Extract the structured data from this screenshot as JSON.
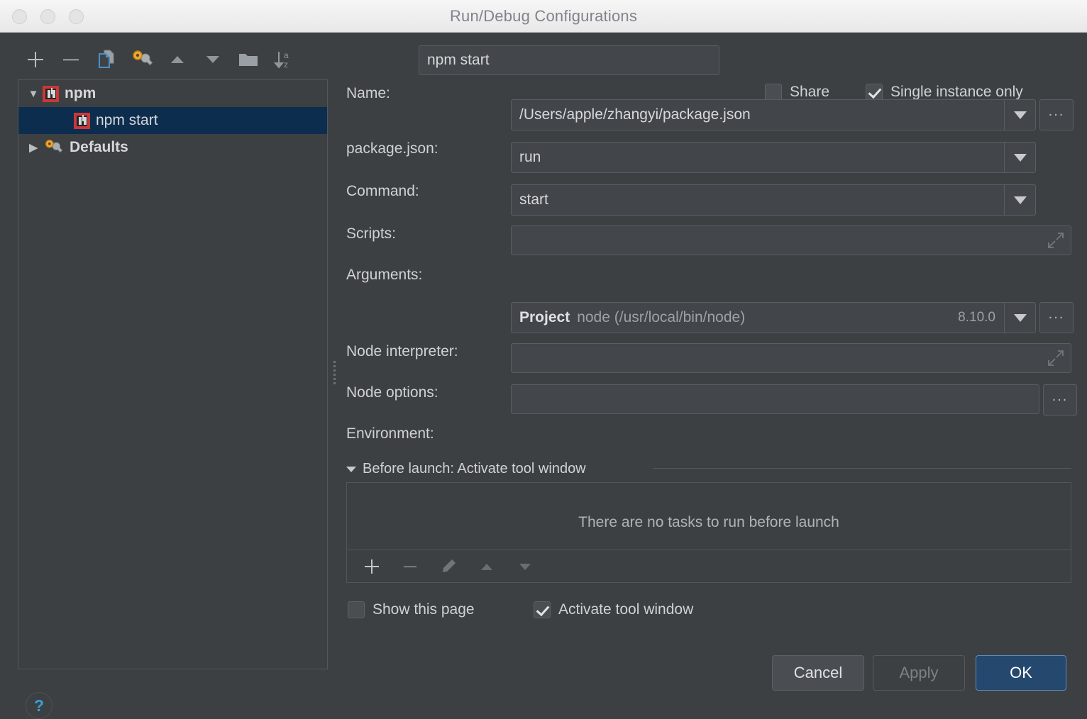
{
  "window": {
    "title": "Run/Debug Configurations",
    "traffic_lights": [
      "close-button",
      "minimize-button",
      "zoom-button"
    ]
  },
  "tree_toolbar": {
    "buttons": [
      {
        "name": "add-configuration-button",
        "icon": "plus-icon",
        "tooltip": "Add New Configuration"
      },
      {
        "name": "remove-configuration-button",
        "icon": "minus-icon",
        "tooltip": "Remove Configuration"
      },
      {
        "name": "copy-configuration-button",
        "icon": "copy-icon",
        "tooltip": "Copy Configuration"
      },
      {
        "name": "edit-defaults-button",
        "icon": "wrench-gear-icon",
        "tooltip": "Edit defaults"
      },
      {
        "name": "move-up-button",
        "icon": "arrow-up-icon",
        "tooltip": "Move Up"
      },
      {
        "name": "move-down-button",
        "icon": "arrow-down-icon",
        "tooltip": "Move Down"
      },
      {
        "name": "create-folder-button",
        "icon": "folder-icon",
        "tooltip": "Create New Folder"
      },
      {
        "name": "sort-button",
        "icon": "sort-alpha-icon",
        "tooltip": "Sort Configurations"
      }
    ]
  },
  "tree": {
    "items": [
      {
        "label": "npm",
        "level": 0,
        "expander": "▼",
        "icon": "npm-icon",
        "selected": false,
        "bold": true
      },
      {
        "label": "npm start",
        "level": 1,
        "expander": "",
        "icon": "npm-icon",
        "selected": true,
        "bold": false
      },
      {
        "label": "Defaults",
        "level": 0,
        "expander": "▶",
        "icon": "wrench-gear-icon",
        "selected": false,
        "bold": true
      }
    ]
  },
  "help": {
    "label": "?",
    "name": "help-button"
  },
  "form": {
    "name": {
      "label": "Name:",
      "value": "npm start"
    },
    "share": {
      "label": "Share",
      "checked": false
    },
    "single_instance": {
      "label": "Single instance only",
      "checked": true
    },
    "package_json": {
      "label": "package.json:",
      "value": "/Users/apple/zhangyi/package.json",
      "browse": "..."
    },
    "command": {
      "label": "Command:",
      "value": "run"
    },
    "scripts": {
      "label": "Scripts:",
      "value": "start"
    },
    "arguments": {
      "label": "Arguments:",
      "value": "",
      "placeholder": ""
    },
    "node_interpreter": {
      "label": "Node interpreter:",
      "scope": "Project",
      "path": "node (/usr/local/bin/node)",
      "version": "8.10.0",
      "browse": "..."
    },
    "node_options": {
      "label": "Node options:",
      "value": "",
      "placeholder": ""
    },
    "environment": {
      "label": "Environment:",
      "value": "",
      "placeholder": "",
      "browse": "..."
    }
  },
  "before_launch": {
    "title": "Before launch: Activate tool window",
    "empty_message": "There are no tasks to run before launch",
    "toolbar": [
      {
        "name": "add-task-button",
        "icon": "plus-icon",
        "enabled": true
      },
      {
        "name": "remove-task-button",
        "icon": "minus-icon",
        "enabled": false
      },
      {
        "name": "edit-task-button",
        "icon": "pencil-icon",
        "enabled": false
      },
      {
        "name": "move-task-up-button",
        "icon": "arrow-up-icon",
        "enabled": false
      },
      {
        "name": "move-task-down-button",
        "icon": "arrow-down-icon",
        "enabled": false
      }
    ],
    "show_this_page": {
      "label": "Show this page",
      "checked": false
    },
    "activate_tool_window": {
      "label": "Activate tool window",
      "checked": true
    }
  },
  "footer": {
    "cancel": "Cancel",
    "apply": "Apply",
    "ok": "OK"
  },
  "colors": {
    "dialog_bg": "#3c4043",
    "field_bg": "#43474b",
    "selection_blue": "#0d2d4e",
    "ok_button_blue": "#24486e",
    "npm_red": "#cb3837",
    "help_blue": "#3a9fd4"
  }
}
